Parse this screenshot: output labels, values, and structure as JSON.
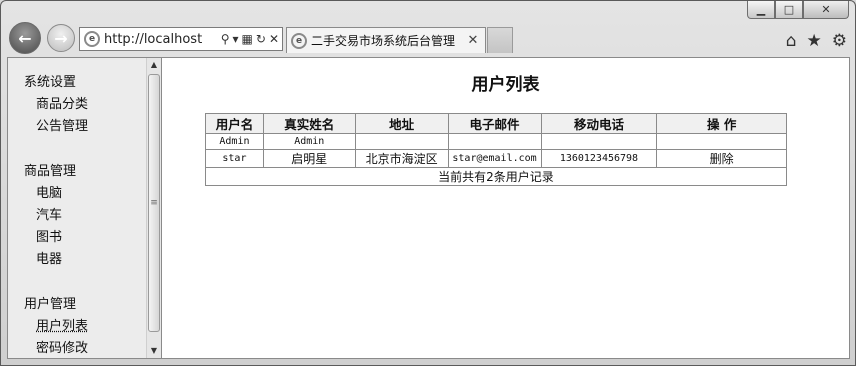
{
  "browser": {
    "url": "http://localhost",
    "tab_title": "二手交易市场系统后台管理",
    "caption": {
      "minimize": "▁",
      "maximize": "□",
      "close": "✕"
    },
    "icons": [
      "back-arrow-icon",
      "forward-arrow-icon",
      "ie-logo-icon",
      "search-icon",
      "dropdown-icon",
      "compat-view-icon",
      "refresh-icon",
      "stop-icon",
      "close-icon",
      "home-icon",
      "favorites-star-icon",
      "gear-icon"
    ]
  },
  "sidebar": {
    "groups": [
      {
        "title": "系统设置",
        "items": [
          "商品分类",
          "公告管理"
        ]
      },
      {
        "title": "商品管理",
        "items": [
          "电脑",
          "汽车",
          "图书",
          "电器"
        ]
      },
      {
        "title": "用户管理",
        "items": [
          "用户列表",
          "密码修改"
        ]
      }
    ]
  },
  "main": {
    "title": "用户列表",
    "table": {
      "headers": [
        "用户名",
        "真实姓名",
        "地址",
        "电子邮件",
        "移动电话",
        "操 作"
      ],
      "rows": [
        [
          "Admin",
          "Admin",
          "",
          "",
          "",
          ""
        ],
        [
          "star",
          "启明星",
          "北京市海淀区",
          "star@email.com",
          "13601234567​98",
          "删除"
        ]
      ],
      "footer": "当前共有2条用户记录"
    }
  }
}
